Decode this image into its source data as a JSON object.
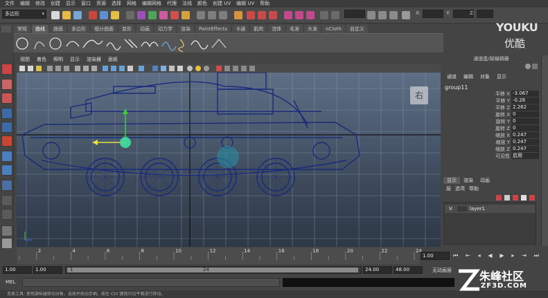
{
  "menubar": [
    "文件",
    "编辑",
    "修改",
    "创建",
    "显示",
    "窗口",
    "资源",
    "选择",
    "网格",
    "编辑网格",
    "代理",
    "法线",
    "颜色",
    "创建 UV",
    "编辑 UV",
    "帮助"
  ],
  "status": {
    "mode": "多边形",
    "x_label": "X:",
    "y_label": "Y:",
    "z_label": "Z:"
  },
  "shelf_tabs": [
    "常规",
    "曲线",
    "曲面",
    "多边形",
    "细分曲面",
    "变形",
    "动画",
    "动力学",
    "渲染",
    "PaintEffects",
    "卡通",
    "肌肉",
    "流体",
    "毛发",
    "头发",
    "nCloth",
    "自定义"
  ],
  "shelf_active": "曲线",
  "panel_menu": [
    "视图",
    "着色",
    "照明",
    "显示",
    "渲染器",
    "面板"
  ],
  "viewport": {
    "view_label": "右"
  },
  "right_panel": {
    "title": "通道盒/层编辑器",
    "tabs": [
      "通道",
      "编辑",
      "对象",
      "显示"
    ],
    "object": "group11",
    "attributes": [
      {
        "label": "平移 X",
        "value": "-3.067"
      },
      {
        "label": "平移 Y",
        "value": "-0.28"
      },
      {
        "label": "平移 Z",
        "value": "2.262"
      },
      {
        "label": "旋转 X",
        "value": "0"
      },
      {
        "label": "旋转 Y",
        "value": "0"
      },
      {
        "label": "旋转 Z",
        "value": "0"
      },
      {
        "label": "缩放 X",
        "value": "0.247"
      },
      {
        "label": "缩放 Y",
        "value": "0.247"
      },
      {
        "label": "缩放 Z",
        "value": "0.247"
      },
      {
        "label": "可见性",
        "value": "启用"
      }
    ],
    "layer_tabs": [
      "显示",
      "渲染",
      "动画"
    ],
    "layer_menu": [
      "层",
      "选项",
      "帮助"
    ],
    "layer": {
      "visible": "V",
      "name": "layer1"
    }
  },
  "timeline": {
    "ticks": [
      "2",
      "4",
      "6",
      "8",
      "10",
      "12",
      "14",
      "16",
      "18",
      "20",
      "22",
      "24"
    ],
    "current": "1.00"
  },
  "range": {
    "start": "1.00",
    "inner_start": "1.00",
    "slider_start": "1",
    "slider_end": "24",
    "inner_end": "24.00",
    "end": "48.00",
    "anim_layer": "无动画层"
  },
  "mel": {
    "label": "MEL"
  },
  "help_line": "变换工具: 使用操纵器移动对象，选择并拖动手柄。按住 Ctrl 键则只沿平面进行移动。",
  "watermark": {
    "youku": "YOUKU",
    "youku_cn": "优酷",
    "zf_name": "朱峰社区",
    "zf_url": "ZF3D.COM"
  }
}
